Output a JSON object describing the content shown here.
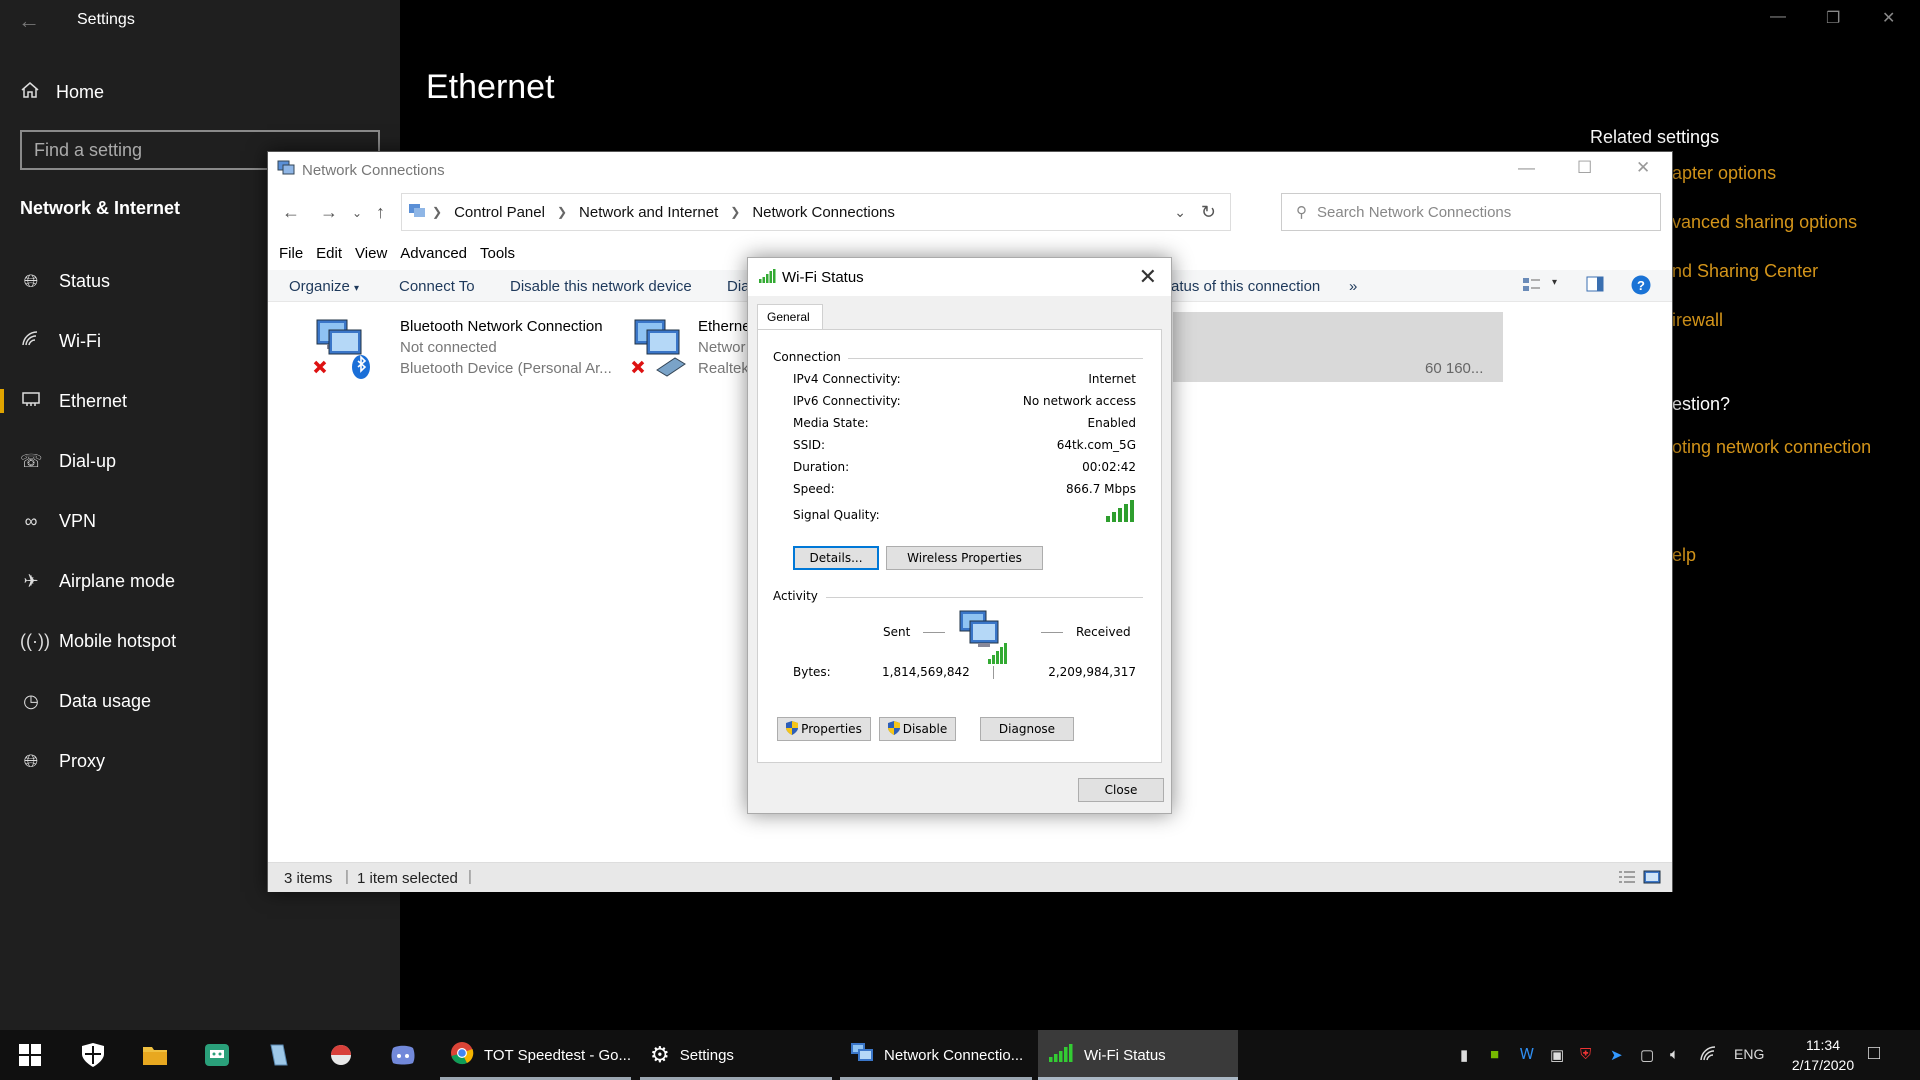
{
  "settings": {
    "window_title": "Settings",
    "home_label": "Home",
    "search_placeholder": "Find a setting",
    "section_title": "Network & Internet",
    "nav": [
      {
        "label": "Status",
        "icon": "globe-icon"
      },
      {
        "label": "Wi-Fi",
        "icon": "wifi-icon"
      },
      {
        "label": "Ethernet",
        "icon": "ethernet-icon"
      },
      {
        "label": "Dial-up",
        "icon": "dialup-icon"
      },
      {
        "label": "VPN",
        "icon": "vpn-icon"
      },
      {
        "label": "Airplane mode",
        "icon": "airplane-icon"
      },
      {
        "label": "Mobile hotspot",
        "icon": "hotspot-icon"
      },
      {
        "label": "Data usage",
        "icon": "data-usage-icon"
      },
      {
        "label": "Proxy",
        "icon": "globe-icon"
      }
    ],
    "active_nav": "Ethernet",
    "page_heading": "Ethernet",
    "related_title": "Related settings",
    "related_links": [
      "apter options",
      "vanced sharing options",
      "nd Sharing Center",
      "irewall"
    ],
    "question_heading": "estion?",
    "question_links": [
      "oting network connection"
    ],
    "help_link": "elp",
    "accent_color": "#d4951a"
  },
  "netconn": {
    "window_title": "Network Connections",
    "breadcrumbs": [
      "Control Panel",
      "Network and Internet",
      "Network Connections"
    ],
    "search_placeholder": "Search Network Connections",
    "menu": [
      "File",
      "Edit",
      "View",
      "Advanced",
      "Tools"
    ],
    "commands": {
      "organize": "Organize",
      "connect_to": "Connect To",
      "disable": "Disable this network device",
      "diagnose_partial": "Dia",
      "status_partial": "atus of this connection",
      "more": "»"
    },
    "items": [
      {
        "name": "Bluetooth Network Connection",
        "status": "Not connected",
        "device": "Bluetooth Device (Personal Ar..."
      },
      {
        "name": "Etherne",
        "status": "Networ",
        "device": "Realtek"
      },
      {
        "name": "",
        "status": "",
        "device": "60 160..."
      }
    ],
    "status_bar": {
      "items": "3 items",
      "selected": "1 item selected"
    }
  },
  "wifi_dialog": {
    "title": "Wi-Fi Status",
    "tab": "General",
    "connection_label": "Connection",
    "fields": [
      {
        "key": "IPv4 Connectivity:",
        "value": "Internet"
      },
      {
        "key": "IPv6 Connectivity:",
        "value": "No network access"
      },
      {
        "key": "Media State:",
        "value": "Enabled"
      },
      {
        "key": "SSID:",
        "value": "64tk.com_5G"
      },
      {
        "key": "Duration:",
        "value": "00:02:42"
      },
      {
        "key": "Speed:",
        "value": "866.7 Mbps"
      }
    ],
    "signal_label": "Signal Quality:",
    "signal_bars": 5,
    "details_button": "Details...",
    "wireless_props_button": "Wireless Properties",
    "activity_label": "Activity",
    "sent_label": "Sent",
    "received_label": "Received",
    "bytes_label": "Bytes:",
    "bytes_sent": "1,814,569,842",
    "bytes_received": "2,209,984,317",
    "properties_button": "Properties",
    "disable_button": "Disable",
    "diagnose_button": "Diagnose",
    "close_button": "Close"
  },
  "taskbar": {
    "apps": [
      {
        "label": "TOT Speedtest - Go...",
        "icon": "chrome-icon"
      },
      {
        "label": "Settings",
        "icon": "gear-icon"
      },
      {
        "label": "Network Connectio...",
        "icon": "network-connections-icon"
      },
      {
        "label": "Wi-Fi Status",
        "icon": "wifi-signal-icon"
      }
    ],
    "language": "ENG",
    "time": "11:34",
    "date": "2/17/2020"
  }
}
